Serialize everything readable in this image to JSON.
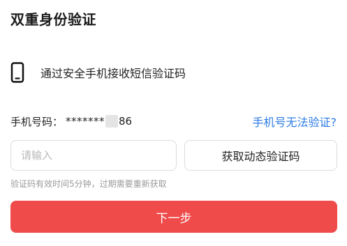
{
  "title": "双重身份验证",
  "method": {
    "icon": "mobile-phone-icon",
    "text": "通过安全手机接收短信验证码"
  },
  "phone": {
    "label": "手机号码：",
    "masked_prefix": "*******",
    "suffix": "86",
    "cannot_verify_link": "手机号无法验证?"
  },
  "code_input": {
    "placeholder": "请输入",
    "value": ""
  },
  "get_code_button": "获取动态验证码",
  "hint": "验证码有效时间5分钟，过期需要重新获取",
  "next_button": "下一步",
  "colors": {
    "primary_button": "#ef4b4b",
    "link": "#2c7be5"
  }
}
